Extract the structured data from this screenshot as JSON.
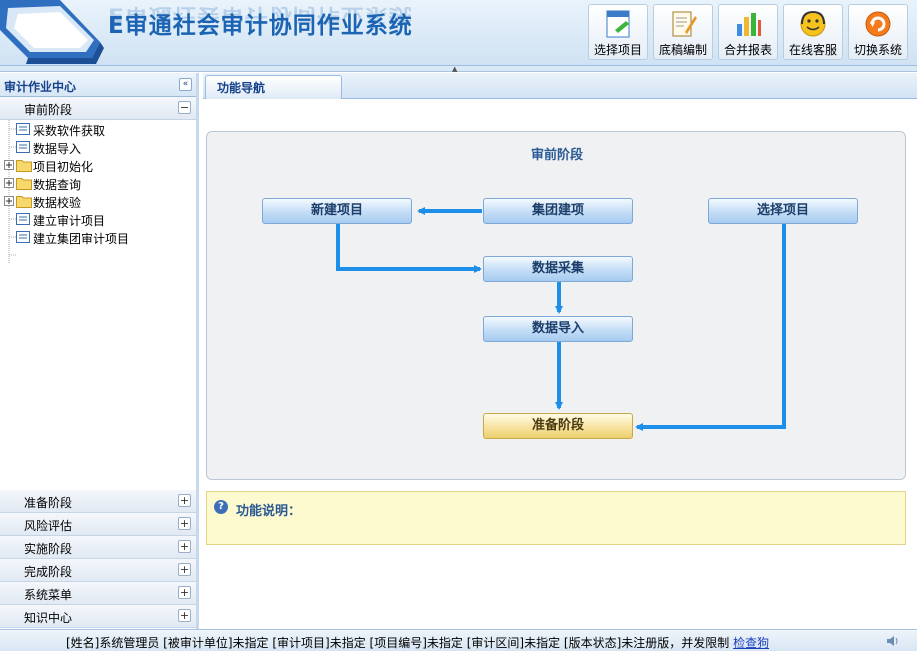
{
  "header": {
    "title": "E审通社会审计协同作业系统",
    "toolbar": [
      {
        "label": "选择项目",
        "icon": "select-project-icon"
      },
      {
        "label": "底稿编制",
        "icon": "worksheet-edit-icon"
      },
      {
        "label": "合并报表",
        "icon": "merge-report-icon"
      },
      {
        "label": "在线客服",
        "icon": "online-support-icon"
      },
      {
        "label": "切换系统",
        "icon": "switch-system-icon"
      }
    ]
  },
  "sidebar": {
    "title": "审计作业中心",
    "active_section": "审前阶段",
    "tree": [
      {
        "label": "采数软件获取",
        "type": "item"
      },
      {
        "label": "数据导入",
        "type": "item"
      },
      {
        "label": "项目初始化",
        "type": "folder"
      },
      {
        "label": "数据查询",
        "type": "folder"
      },
      {
        "label": "数据校验",
        "type": "folder"
      },
      {
        "label": "建立审计项目",
        "type": "item"
      },
      {
        "label": "建立集团审计项目",
        "type": "item"
      }
    ],
    "sections": [
      "准备阶段",
      "风险评估",
      "实施阶段",
      "完成阶段",
      "系统菜单",
      "知识中心"
    ]
  },
  "main": {
    "tab": "功能导航",
    "flow": {
      "title": "审前阶段",
      "nodes": {
        "new_project": "新建项目",
        "group_project": "集团建项",
        "select_project": "选择项目",
        "data_collect": "数据采集",
        "data_import": "数据导入",
        "prepare_stage": "准备阶段"
      }
    },
    "description_label": "功能说明："
  },
  "status": {
    "text": "[姓名]系统管理员 [被审计单位]未指定 [审计项目]未指定 [项目编号]未指定 [审计区间]未指定 [版本状态]未注册版，并发限制",
    "link": "检查狗"
  },
  "colors": {
    "accent": "#1b63b3",
    "arrow": "#1e8fe8",
    "flow_button": "#c4ddf6",
    "highlight_button": "#f7e3a0",
    "description_bg": "#fefad0"
  }
}
